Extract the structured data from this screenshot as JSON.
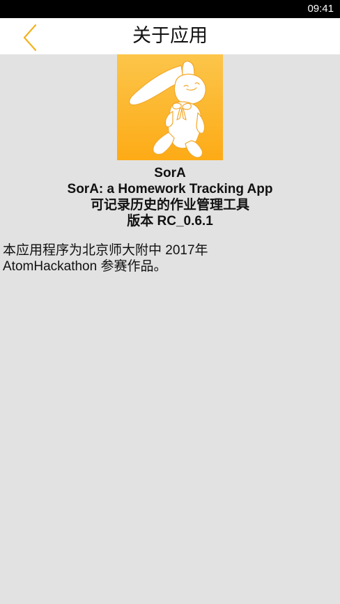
{
  "status_bar": {
    "time": "09:41"
  },
  "toolbar": {
    "title": "关于应用",
    "back_icon": "chevron-left-icon",
    "accent_color": "#f5b21e"
  },
  "app": {
    "icon": "rabbit-icon",
    "icon_colors": [
      "#fcc54a",
      "#fdab16"
    ],
    "name": "SorA",
    "tagline_en": "SorA: a Homework Tracking App",
    "tagline_zh": "可记录历史的作业管理工具",
    "version": "版本 RC_0.6.1"
  },
  "description": {
    "line1": "本应用程序为北京师大附中 2017年",
    "line2": "AtomHackathon 参赛作品。"
  }
}
